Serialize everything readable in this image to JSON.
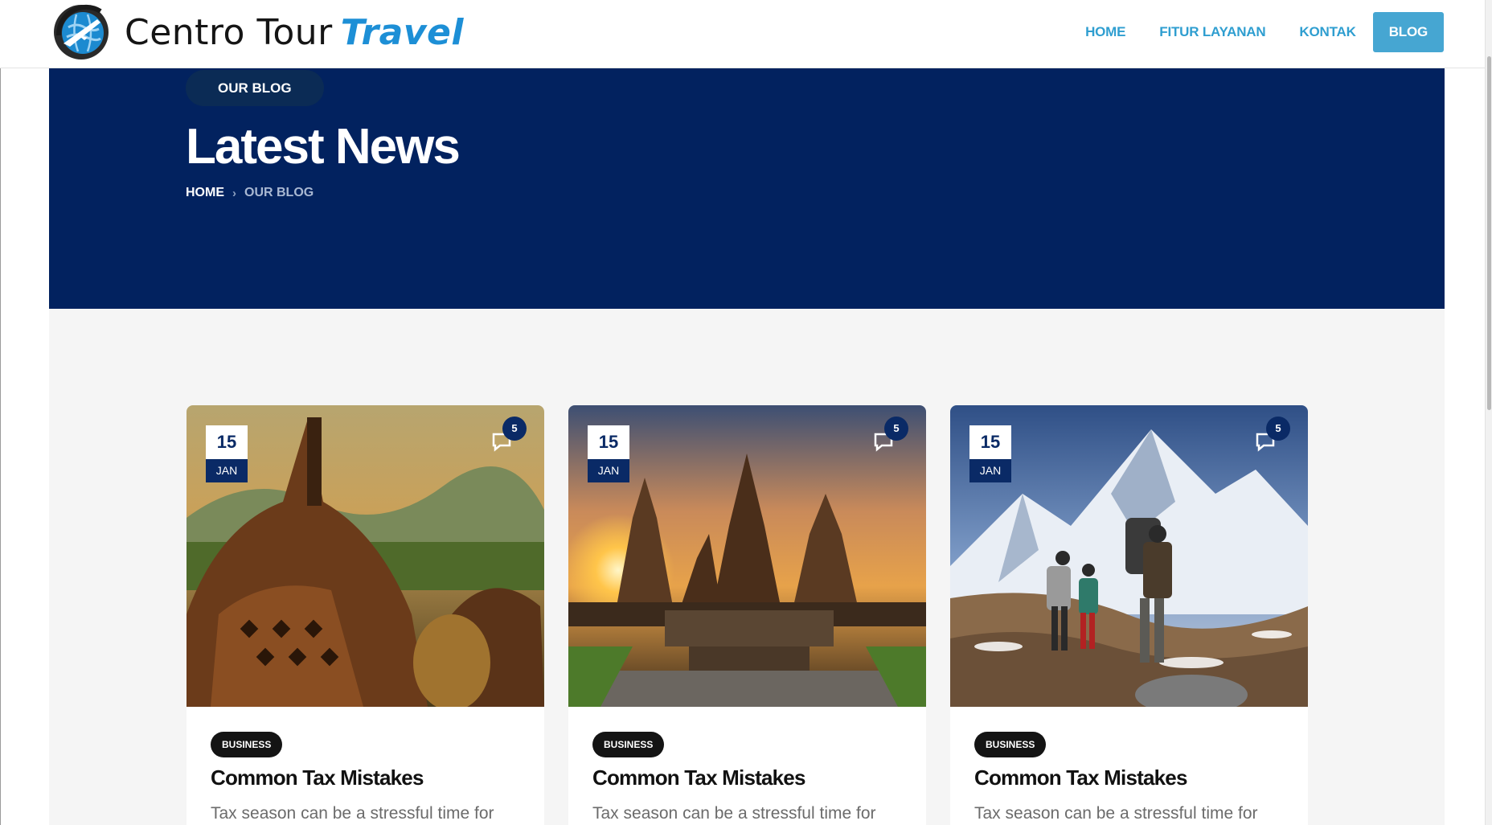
{
  "brand": {
    "name": "Centro Tour",
    "accent": "Travel",
    "logo_icon": "globe-plane-icon"
  },
  "nav": {
    "items": [
      {
        "label": "HOME"
      },
      {
        "label": "FITUR LAYANAN"
      },
      {
        "label": "KONTAK"
      },
      {
        "label": "BLOG",
        "active": true
      }
    ]
  },
  "hero": {
    "pill": "OUR BLOG",
    "title": "Latest News",
    "breadcrumb": {
      "home": "HOME",
      "separator_icon": "chevron-right-icon",
      "current": "OUR BLOG"
    }
  },
  "posts": [
    {
      "day": "15",
      "month": "JAN",
      "comments": "5",
      "tag": "BUSINESS",
      "title": "Common Tax Mistakes",
      "excerpt": "Tax season can be a stressful time for",
      "image": "borobudur-temple-photo"
    },
    {
      "day": "15",
      "month": "JAN",
      "comments": "5",
      "tag": "BUSINESS",
      "title": "Common Tax Mistakes",
      "excerpt": "Tax season can be a stressful time for",
      "image": "prambanan-sunset-photo"
    },
    {
      "day": "15",
      "month": "JAN",
      "comments": "5",
      "tag": "BUSINESS",
      "title": "Common Tax Mistakes",
      "excerpt": "Tax season can be a stressful time for",
      "image": "mountain-hikers-photo"
    }
  ],
  "colors": {
    "navy": "#02225f",
    "nav_link": "#2f9ed0",
    "nav_active_bg": "#46a6d2",
    "brand_accent": "#1d8fd6"
  }
}
